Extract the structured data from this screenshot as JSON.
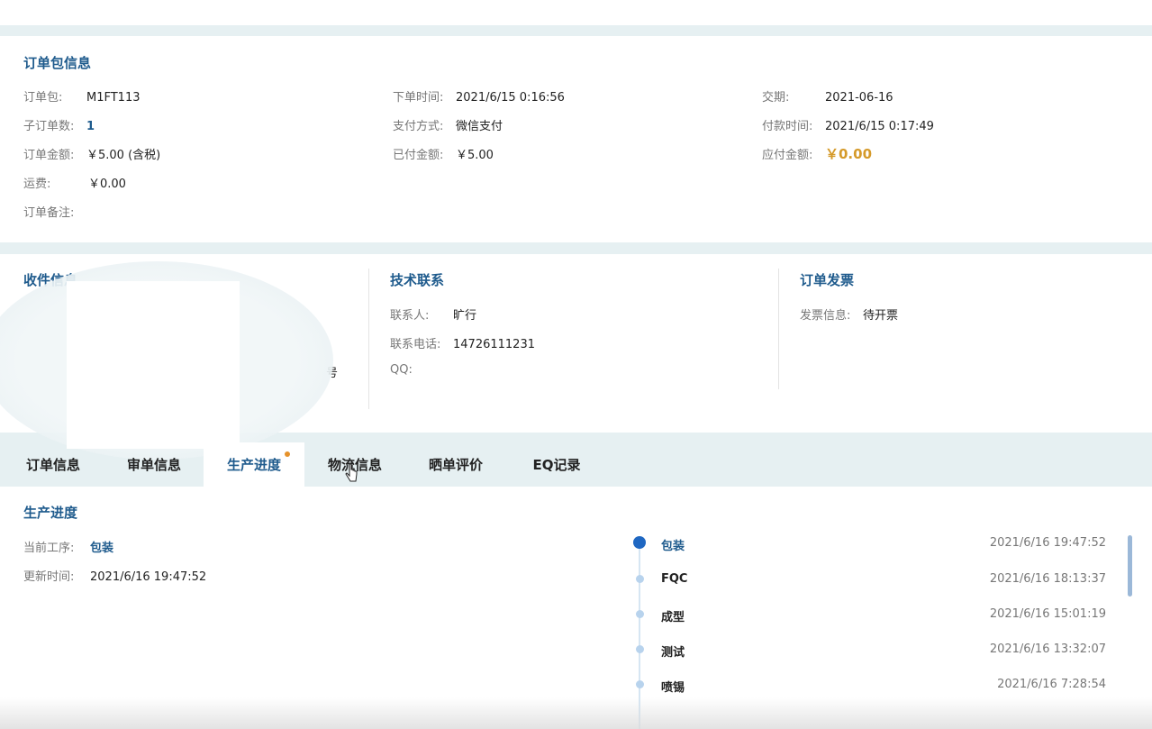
{
  "order_package": {
    "title": "订单包信息",
    "package_label": "订单包:",
    "package_value": "M1FT113",
    "order_time_label": "下单时间:",
    "order_time_value": "2021/6/15 0:16:56",
    "delivery_label": "交期:",
    "delivery_value": "2021-06-16",
    "sub_orders_label": "子订单数:",
    "sub_orders_value": "1",
    "payment_method_label": "支付方式:",
    "payment_method_value": "微信支付",
    "payment_time_label": "付款时间:",
    "payment_time_value": "2021/6/15 0:17:49",
    "order_amount_label": "订单金额:",
    "order_amount_value": "￥5.00 (含税)",
    "paid_amount_label": "已付金额:",
    "paid_amount_value": "￥5.00",
    "payable_label": "应付金额:",
    "payable_value": "￥0.00",
    "shipping_label": "运费:",
    "shipping_value": "￥0.00",
    "remark_label": "订单备注:",
    "remark_value": ""
  },
  "receiver": {
    "title": "收件信息",
    "partial_text": "号"
  },
  "tech_contact": {
    "title": "技术联系",
    "contact_label": "联系人:",
    "contact_value": "旷行",
    "phone_label": "联系电话:",
    "phone_value": "14726111231",
    "qq_label": "QQ:",
    "qq_value": ""
  },
  "invoice": {
    "title": "订单发票",
    "info_label": "发票信息:",
    "info_value": "待开票"
  },
  "tabs": [
    {
      "label": "订单信息"
    },
    {
      "label": "审单信息"
    },
    {
      "label": "生产进度"
    },
    {
      "label": "物流信息"
    },
    {
      "label": "晒单评价"
    },
    {
      "label": "EQ记录"
    }
  ],
  "production": {
    "title": "生产进度",
    "current_step_label": "当前工序:",
    "current_step_value": "包装",
    "update_time_label": "更新时间:",
    "update_time_value": "2021/6/16 19:47:52",
    "timeline": [
      {
        "name": "包装",
        "time": "2021/6/16 19:47:52"
      },
      {
        "name": "FQC",
        "time": "2021/6/16 18:13:37"
      },
      {
        "name": "成型",
        "time": "2021/6/16 15:01:19"
      },
      {
        "name": "测试",
        "time": "2021/6/16 13:32:07"
      },
      {
        "name": "喷锡",
        "time": "2021/6/16 7:28:54"
      }
    ]
  },
  "colors": {
    "accent_blue": "#1f5b8d",
    "amount_orange": "#d59a2a",
    "tab_dot": "#e6922b",
    "page_bg": "#e6f0f2"
  },
  "icons": [
    "mouse-cursor-icon"
  ]
}
